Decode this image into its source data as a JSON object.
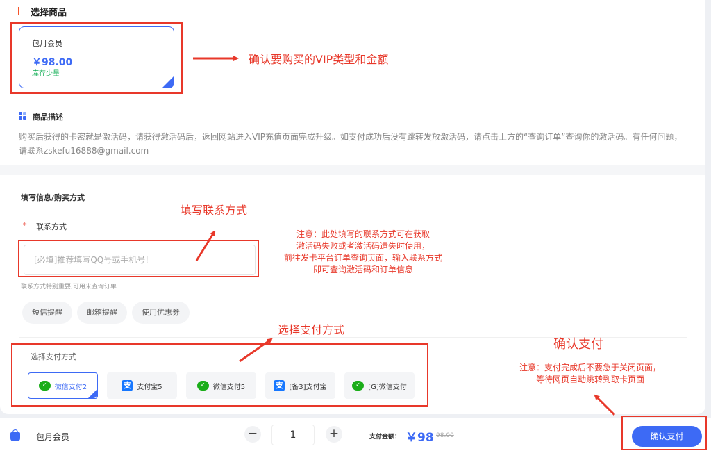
{
  "product_section": {
    "title": "选择商品"
  },
  "product": {
    "name": "包月会员",
    "price": "￥98.00",
    "stock": "库存少量"
  },
  "description": {
    "title": "商品描述",
    "text": "购买后获得的卡密就是激活码，请获得激活码后，返回网站进入VIP充值页面完成升级。如支付成功后没有跳转发放激活码，请点击上方的“查询订单”查询你的激活码。有任何问题，请联系zskefu16888@gmail.com"
  },
  "fill_section": {
    "title": "填写信息/购买方式"
  },
  "contact": {
    "star": "*",
    "label": "联系方式",
    "placeholder": "[必填]推荐填写QQ号或手机号!",
    "hint": "联系方式特别重要,可用来查询订单"
  },
  "options": [
    "短信提醒",
    "邮箱提醒",
    "使用优惠券"
  ],
  "payment": {
    "label": "选择支付方式",
    "methods": [
      {
        "label": "微信支付2",
        "icon": "wechat-pay-icon"
      },
      {
        "label": "支付宝5",
        "icon": "alipay-icon"
      },
      {
        "label": "微信支付5",
        "icon": "wechat-pay-icon"
      },
      {
        "label": "[备3]支付宝",
        "icon": "alipay-icon"
      },
      {
        "label": "[G]微信支付",
        "icon": "wechat-pay-icon"
      }
    ],
    "alipay_glyph": "支"
  },
  "bottom": {
    "name": "包月会员",
    "minus": "−",
    "plus": "+",
    "quantity": "1",
    "total_label": "支付金额：",
    "total": "￥98",
    "original": "98.00",
    "confirm": "确认支付"
  },
  "annotations": {
    "vip": "确认要购买的VIP类型和金额",
    "contact": "填写联系方式",
    "contact_note": [
      "注意：此处填写的联系方式可在获取",
      "激活码失败或者激活码遗失时使用，",
      "前往发卡平台订单查询页面，输入联系方式",
      "即可查询激活码和订单信息"
    ],
    "payment": "选择支付方式",
    "confirm": "确认支付",
    "confirm_note": [
      "注意：支付完成后不要急于关闭页面，",
      "等待网页自动跳转到取卡页面"
    ]
  },
  "colors": {
    "accent": "#3d6af5",
    "annotation": "#e8382a",
    "stock": "#19b05a"
  }
}
